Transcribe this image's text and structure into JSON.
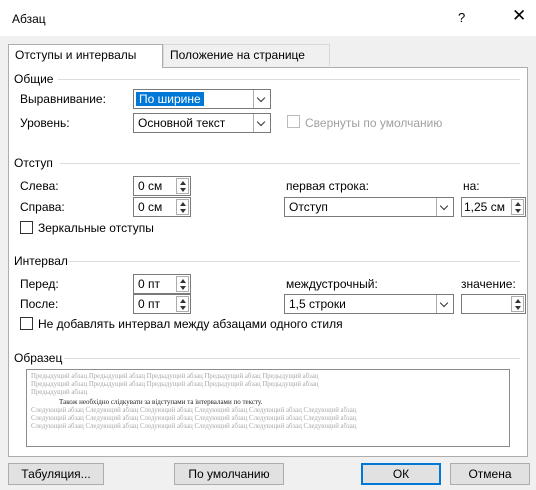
{
  "window": {
    "title": "Абзац",
    "help": "?",
    "close": "✕"
  },
  "tabs": [
    {
      "label": "Отступы и интервалы",
      "active": true
    },
    {
      "label": "Положение на странице",
      "active": false
    }
  ],
  "general": {
    "heading": "Общие",
    "alignment_label": "Выравнивание:",
    "alignment_value": "По ширине",
    "level_label": "Уровень:",
    "level_value": "Основной текст",
    "collapsed_label": "Свернуты по умолчанию"
  },
  "indent": {
    "heading": "Отступ",
    "left_label": "Слева:",
    "left_value": "0 см",
    "right_label": "Справа:",
    "right_value": "0 см",
    "first_line_label": "первая строка:",
    "first_line_value": "Отступ",
    "by_label": "на:",
    "by_value": "1,25 см",
    "mirror_label": "Зеркальные отступы"
  },
  "spacing": {
    "heading": "Интервал",
    "before_label": "Перед:",
    "before_value": "0 пт",
    "after_label": "После:",
    "after_value": "0 пт",
    "line_spacing_label": "междустрочный:",
    "line_spacing_value": "1,5 строки",
    "at_label": "значение:",
    "at_value": "",
    "dont_add_label": "Не добавлять интервал между абзацами одного стиля"
  },
  "preview": {
    "heading": "Образец",
    "prev_lines": [
      "Предыдущий абзац Предыдущий абзац Предыдущий абзац Предыдущий абзац Предыдущий абзац",
      "Предыдущий абзац Предыдущий абзац Предыдущий абзац Предыдущий абзац Предыдущий абзац",
      "Предыдущий абзац"
    ],
    "sample_line": "Також необхідно слідкувати за відступами та інтервалами по тексту.",
    "next_lines": [
      "Следующий абзац Следующий абзац Следующий абзац Следующий абзац Следующий абзац Следующий абзац",
      "Следующий абзац Следующий абзац Следующий абзац Следующий абзац Следующий абзац Следующий абзац",
      "Следующий абзац Следующий абзац Следующий абзац Следующий абзац Следующий абзац Следующий абзац"
    ]
  },
  "buttons": {
    "tabs": "Табуляция...",
    "default": "По умолчанию",
    "ok": "ОК",
    "cancel": "Отмена"
  },
  "colors": {
    "accent": "#0078d7",
    "client_bg": "#f0f0f0"
  }
}
